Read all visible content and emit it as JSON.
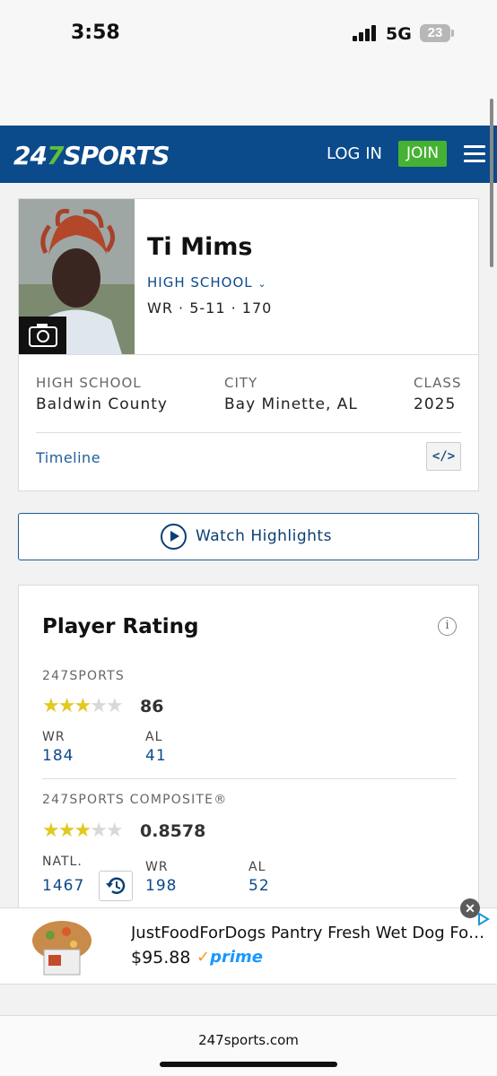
{
  "status": {
    "time": "3:58",
    "network": "5G",
    "battery": "23"
  },
  "nav": {
    "logo_prefix": "24",
    "logo_seven": "7",
    "logo_suffix": "SPORTS",
    "login": "LOG IN",
    "join": "JOIN"
  },
  "player": {
    "name": "Ti Mims",
    "school_link": "HIGH SCHOOL",
    "position_line": "WR · 5-11 · 170",
    "high_school_label": "HIGH SCHOOL",
    "high_school": "Baldwin County",
    "city_label": "CITY",
    "city": "Bay Minette, AL",
    "class_label": "CLASS",
    "class": "2025",
    "timeline": "Timeline",
    "embed": "</>"
  },
  "watch": {
    "label": "Watch Highlights"
  },
  "rating": {
    "title": "Player Rating",
    "info": "i",
    "sports247": {
      "label": "247SPORTS",
      "stars": 3,
      "stars_max": 5,
      "score": "86",
      "ranks": [
        {
          "label": "WR",
          "value": "184"
        },
        {
          "label": "AL",
          "value": "41"
        }
      ]
    },
    "composite": {
      "label": "247SPORTS COMPOSITE®",
      "stars": 3,
      "stars_max": 5,
      "score": "0.8578",
      "ranks": [
        {
          "label": "NATL.",
          "value": "1467"
        },
        {
          "label": "WR",
          "value": "198"
        },
        {
          "label": "AL",
          "value": "52"
        }
      ]
    }
  },
  "ad": {
    "title": "JustFoodForDogs Pantry Fresh Wet Dog Foo…",
    "price": "$95.88",
    "prime_check": "✓",
    "prime": "prime",
    "close": "✕"
  },
  "footer": {
    "url": "247sports.com"
  }
}
